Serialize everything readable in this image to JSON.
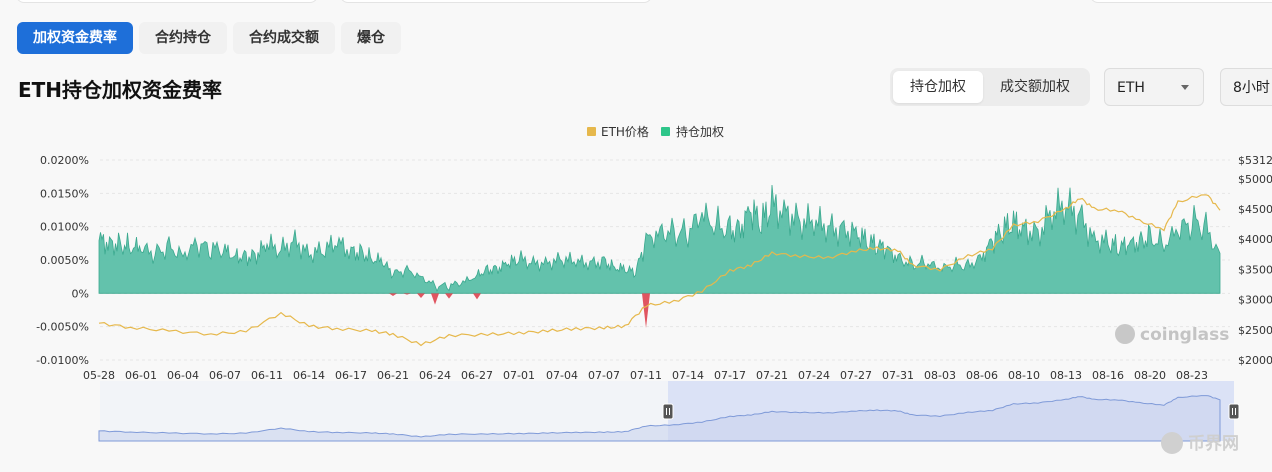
{
  "tabs": [
    "加权资金费率",
    "合约持仓",
    "合约成交额",
    "爆仓"
  ],
  "active_tab": 0,
  "page_title": "ETH持仓加权资金费率",
  "weight_toggle": {
    "options": [
      "持仓加权",
      "成交额加权"
    ],
    "active": 0
  },
  "coin_select": {
    "value": "ETH",
    "icon": "chevron-down-icon"
  },
  "interval_select": {
    "value": "8小时"
  },
  "watermark": {
    "brand": "coinglass"
  },
  "corner_logo": {
    "text": "币界网"
  },
  "colors": {
    "accent": "#1e6fd9",
    "price": "#e6b84c",
    "positive": "#5bbfa8",
    "negative": "#e05560",
    "navigator": "#7f9ad8"
  },
  "chart_data": {
    "type": "area",
    "legend": [
      "ETH价格",
      "持仓加权"
    ],
    "legend_position": "top-center",
    "grid": true,
    "x_tick_labels": [
      "05-28",
      "06-01",
      "06-04",
      "06-07",
      "06-11",
      "06-14",
      "06-17",
      "06-21",
      "06-24",
      "06-27",
      "07-01",
      "07-04",
      "07-07",
      "07-11",
      "07-14",
      "07-17",
      "07-21",
      "07-24",
      "07-27",
      "07-31",
      "08-03",
      "08-06",
      "08-10",
      "08-13",
      "08-16",
      "08-20",
      "08-23"
    ],
    "y_left": {
      "ticks": [
        "0.0200%",
        "0.0150%",
        "0.0100%",
        "0.0050%",
        "0%",
        "-0.0050%",
        "-0.0100%"
      ],
      "range": [
        -0.01,
        0.02
      ]
    },
    "y_right": {
      "ticks": [
        "$5312",
        "$5000",
        "$4500",
        "$4000",
        "$3500",
        "$3000",
        "$2500",
        "$2000"
      ],
      "range": [
        2000,
        5312
      ]
    },
    "series": [
      {
        "name": "持仓加权",
        "type": "area",
        "points": [
          [
            "05-28",
            0.0079
          ],
          [
            "05-29",
            0.0076
          ],
          [
            "05-30",
            0.0072
          ],
          [
            "05-31",
            0.0071
          ],
          [
            "06-01",
            0.0065
          ],
          [
            "06-02",
            0.0061
          ],
          [
            "06-03",
            0.0068
          ],
          [
            "06-04",
            0.006
          ],
          [
            "06-05",
            0.0071
          ],
          [
            "06-06",
            0.0068
          ],
          [
            "06-07",
            0.0062
          ],
          [
            "06-08",
            0.0057
          ],
          [
            "06-09",
            0.0054
          ],
          [
            "06-10",
            0.0058
          ],
          [
            "06-11",
            0.0072
          ],
          [
            "06-12",
            0.0065
          ],
          [
            "06-13",
            0.0079
          ],
          [
            "06-14",
            0.0059
          ],
          [
            "06-15",
            0.0064
          ],
          [
            "06-16",
            0.0075
          ],
          [
            "06-17",
            0.0063
          ],
          [
            "06-18",
            0.0061
          ],
          [
            "06-19",
            0.0053
          ],
          [
            "06-20",
            0.0046
          ],
          [
            "06-21",
            0.003
          ],
          [
            "06-22",
            0.0034
          ],
          [
            "06-23",
            0.0026
          ],
          [
            "06-24",
            0.001
          ],
          [
            "06-25",
            0.0012
          ],
          [
            "06-26",
            0.0015
          ],
          [
            "06-27",
            0.0028
          ],
          [
            "06-28",
            0.0035
          ],
          [
            "06-29",
            0.0038
          ],
          [
            "06-30",
            0.0044
          ],
          [
            "07-01",
            0.0052
          ],
          [
            "07-02",
            0.0045
          ],
          [
            "07-03",
            0.0046
          ],
          [
            "07-04",
            0.0051
          ],
          [
            "07-05",
            0.0047
          ],
          [
            "07-06",
            0.0045
          ],
          [
            "07-07",
            0.0048
          ],
          [
            "07-08",
            0.004
          ],
          [
            "07-09",
            0.0035
          ],
          [
            "07-10",
            0.0032
          ],
          [
            "07-11",
            0.0077
          ],
          [
            "07-12",
            0.0096
          ],
          [
            "07-13",
            0.0088
          ],
          [
            "07-14",
            0.0094
          ],
          [
            "07-15",
            0.0113
          ],
          [
            "07-16",
            0.0106
          ],
          [
            "07-17",
            0.0093
          ],
          [
            "07-18",
            0.0101
          ],
          [
            "07-19",
            0.0122
          ],
          [
            "07-20",
            0.0106
          ],
          [
            "07-21",
            0.0132
          ],
          [
            "07-22",
            0.0123
          ],
          [
            "07-23",
            0.0107
          ],
          [
            "07-24",
            0.0106
          ],
          [
            "07-25",
            0.0098
          ],
          [
            "07-26",
            0.0094
          ],
          [
            "07-27",
            0.0094
          ],
          [
            "07-28",
            0.0076
          ],
          [
            "07-29",
            0.0073
          ],
          [
            "07-30",
            0.0064
          ],
          [
            "07-31",
            0.0055
          ],
          [
            "08-01",
            0.0042
          ],
          [
            "08-02",
            0.0048
          ],
          [
            "08-03",
            0.0035
          ],
          [
            "08-04",
            0.0044
          ],
          [
            "08-05",
            0.004
          ],
          [
            "08-06",
            0.0057
          ],
          [
            "08-07",
            0.0077
          ],
          [
            "08-08",
            0.0096
          ],
          [
            "08-09",
            0.0103
          ],
          [
            "08-10",
            0.0098
          ],
          [
            "08-11",
            0.0089
          ],
          [
            "08-12",
            0.012
          ],
          [
            "08-13",
            0.013
          ],
          [
            "08-14",
            0.0115
          ],
          [
            "08-15",
            0.0083
          ],
          [
            "08-16",
            0.0075
          ],
          [
            "08-17",
            0.0069
          ],
          [
            "08-18",
            0.0071
          ],
          [
            "08-19",
            0.008
          ],
          [
            "08-20",
            0.0083
          ],
          [
            "08-21",
            0.0076
          ],
          [
            "08-22",
            0.009
          ],
          [
            "08-23",
            0.011
          ],
          [
            "08-24",
            0.0096
          ],
          [
            "08-25",
            0.006
          ]
        ],
        "negative_spikes": [
          [
            "06-21",
            -0.0004
          ],
          [
            "06-22",
            -0.0002
          ],
          [
            "06-23",
            -0.0007
          ],
          [
            "06-24",
            -0.0017
          ],
          [
            "06-25",
            -0.0008
          ],
          [
            "06-27",
            -0.0009
          ],
          [
            "07-11",
            -0.0052
          ]
        ]
      },
      {
        "name": "ETH价格",
        "type": "line",
        "points": [
          [
            "05-28",
            2610
          ],
          [
            "05-31",
            2540
          ],
          [
            "06-03",
            2480
          ],
          [
            "06-06",
            2430
          ],
          [
            "06-09",
            2470
          ],
          [
            "06-12",
            2780
          ],
          [
            "06-14",
            2560
          ],
          [
            "06-16",
            2520
          ],
          [
            "06-19",
            2480
          ],
          [
            "06-21",
            2430
          ],
          [
            "06-23",
            2250
          ],
          [
            "06-25",
            2410
          ],
          [
            "06-28",
            2420
          ],
          [
            "07-01",
            2450
          ],
          [
            "07-03",
            2480
          ],
          [
            "07-05",
            2520
          ],
          [
            "07-07",
            2530
          ],
          [
            "07-09",
            2560
          ],
          [
            "07-11",
            2900
          ],
          [
            "07-13",
            2970
          ],
          [
            "07-15",
            3140
          ],
          [
            "07-17",
            3480
          ],
          [
            "07-19",
            3570
          ],
          [
            "07-21",
            3770
          ],
          [
            "07-23",
            3720
          ],
          [
            "07-25",
            3690
          ],
          [
            "07-27",
            3810
          ],
          [
            "07-29",
            3850
          ],
          [
            "07-31",
            3820
          ],
          [
            "08-01",
            3570
          ],
          [
            "08-03",
            3500
          ],
          [
            "08-05",
            3720
          ],
          [
            "08-07",
            3850
          ],
          [
            "08-09",
            4230
          ],
          [
            "08-11",
            4300
          ],
          [
            "08-13",
            4500
          ],
          [
            "08-14",
            4690
          ],
          [
            "08-15",
            4500
          ],
          [
            "08-17",
            4480
          ],
          [
            "08-19",
            4300
          ],
          [
            "08-21",
            4170
          ],
          [
            "08-22",
            4610
          ],
          [
            "08-24",
            4760
          ],
          [
            "08-25",
            4480
          ]
        ]
      }
    ]
  }
}
